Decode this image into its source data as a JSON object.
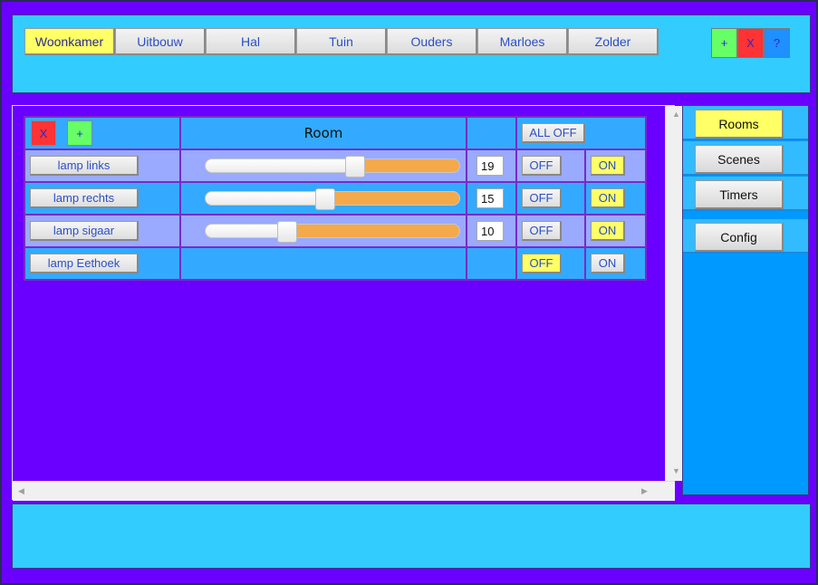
{
  "room_tabs": [
    "Woonkamer",
    "Uitbouw",
    "Hal",
    "Tuin",
    "Ouders",
    "Marloes",
    "Zolder"
  ],
  "active_room_tab": 0,
  "top_buttons": {
    "add": "+",
    "remove": "X",
    "help": "?"
  },
  "table_header": {
    "remove": "X",
    "add": "+",
    "title": "Room",
    "all_off": "ALL OFF"
  },
  "lamps": [
    {
      "name": "lamp links",
      "dimmable": true,
      "level": 19,
      "off": "OFF",
      "on": "ON",
      "state": "on",
      "slider_fraction": 0.59
    },
    {
      "name": "lamp rechts",
      "dimmable": true,
      "level": 15,
      "off": "OFF",
      "on": "ON",
      "state": "on",
      "slider_fraction": 0.47
    },
    {
      "name": "lamp sigaar",
      "dimmable": true,
      "level": 10,
      "off": "OFF",
      "on": "ON",
      "state": "on",
      "slider_fraction": 0.32
    },
    {
      "name": "lamp Eethoek",
      "dimmable": false,
      "level": null,
      "off": "OFF",
      "on": "ON",
      "state": "off",
      "slider_fraction": null
    }
  ],
  "side_menu": [
    "Rooms",
    "Scenes",
    "Timers",
    "Config"
  ],
  "active_side_item": 0,
  "colors": {
    "background": "#6a00ff",
    "panel": "#33ccff",
    "highlight": "#ffff66",
    "slider_fill": "#f4a94a"
  }
}
